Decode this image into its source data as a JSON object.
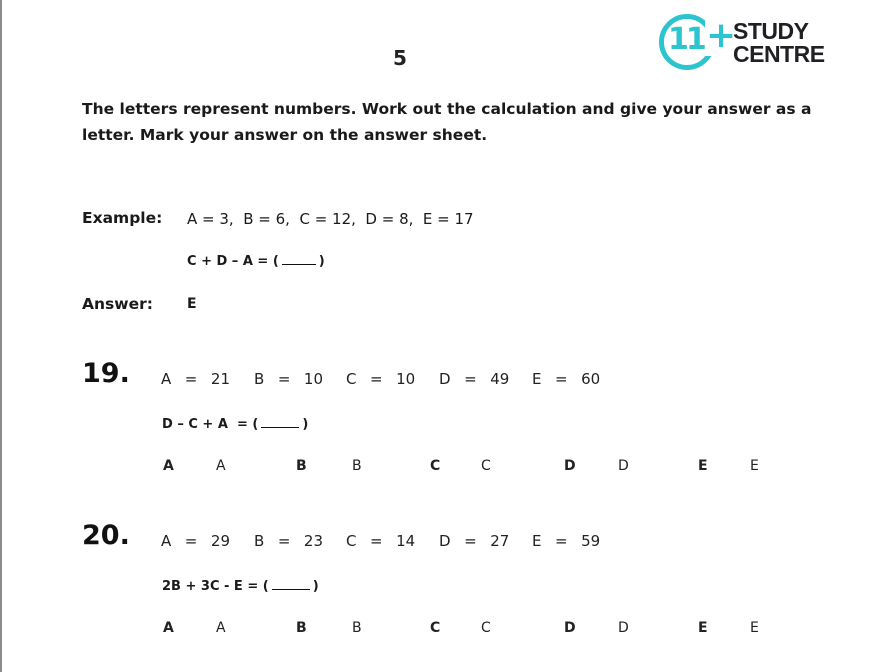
{
  "page": {
    "number": "5"
  },
  "logo": {
    "mark": "11",
    "plus": "+",
    "line1": "STUDY",
    "line2": "CENTRE",
    "brand_color": "#2cc4cf"
  },
  "instructions": "The letters represent numbers.  Work out the calculation and give your answer as a letter.  Mark your answer on the answer sheet.",
  "example": {
    "label": "Example:",
    "values": "A = 3,  B = 6,  C = 12,  D = 8,  E = 17",
    "equation_prefix": "C + D – A = (",
    "equation_suffix": ")",
    "answer_label": "Answer:",
    "answer": "E"
  },
  "questions": [
    {
      "number": "19.",
      "values": [
        {
          "text": "A  =  21"
        },
        {
          "text": "B  =  10"
        },
        {
          "text": "C  =  10"
        },
        {
          "text": "D  =  49"
        },
        {
          "text": "E  =  60"
        }
      ],
      "equation_prefix": "D – C + A  = (",
      "equation_suffix": ")",
      "options": [
        {
          "letter": "A",
          "value": "A"
        },
        {
          "letter": "B",
          "value": "B"
        },
        {
          "letter": "C",
          "value": "C"
        },
        {
          "letter": "D",
          "value": "D"
        },
        {
          "letter": "E",
          "value": "E"
        }
      ]
    },
    {
      "number": "20.",
      "values": [
        {
          "text": "A  =  29"
        },
        {
          "text": "B  =  23"
        },
        {
          "text": "C  =  14"
        },
        {
          "text": "D  =  27"
        },
        {
          "text": "E  =  59"
        }
      ],
      "equation_prefix": "2B + 3C - E = (",
      "equation_suffix": ")",
      "options": [
        {
          "letter": "A",
          "value": "A"
        },
        {
          "letter": "B",
          "value": "B"
        },
        {
          "letter": "C",
          "value": "C"
        },
        {
          "letter": "D",
          "value": "D"
        },
        {
          "letter": "E",
          "value": "E"
        }
      ]
    }
  ]
}
